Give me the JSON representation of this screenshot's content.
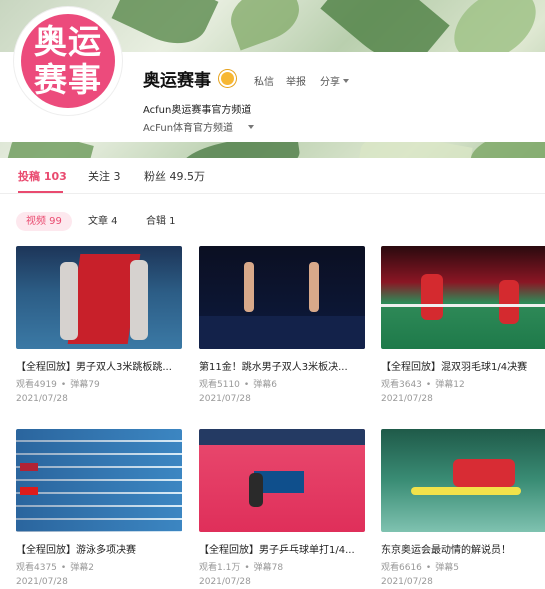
{
  "header": {
    "avatar_text": "奥运\n赛事",
    "username": "奥运赛事",
    "actions": [
      "私信",
      "举报",
      "分享"
    ],
    "signature": "Acfun奥运赛事官方频道",
    "verify": "AcFun体育官方频道"
  },
  "tabs": [
    {
      "label": "投稿 103",
      "active": true
    },
    {
      "label": "关注 3",
      "active": false
    },
    {
      "label": "粉丝 49.5万",
      "active": false
    }
  ],
  "subtabs": [
    {
      "label": "视频 99",
      "active": true
    },
    {
      "label": "文章 4",
      "active": false
    },
    {
      "label": "合辑 1",
      "active": false
    }
  ],
  "videos": [
    {
      "title": "【全程回放】男子双人3米跳板跳...",
      "views": "观看4919",
      "danmaku": "弹幕79",
      "date": "2021/07/28"
    },
    {
      "title": "第11金！跳水男子双人3米板决...",
      "views": "观看5110",
      "danmaku": "弹幕6",
      "date": "2021/07/28"
    },
    {
      "title": "【全程回放】混双羽毛球1/4决赛",
      "views": "观看3643",
      "danmaku": "弹幕12",
      "date": "2021/07/28"
    },
    {
      "title": "【全程回放】游泳多项决赛",
      "views": "观看4375",
      "danmaku": "弹幕2",
      "date": "2021/07/28"
    },
    {
      "title": "【全程回放】男子乒乓球单打1/4...",
      "views": "观看1.1万",
      "danmaku": "弹幕78",
      "date": "2021/07/28"
    },
    {
      "title": "东京奥运会最动情的解说员！",
      "views": "观看6616",
      "danmaku": "弹幕5",
      "date": "2021/07/28"
    }
  ],
  "colors": {
    "accent": "#e94a6f",
    "avatar_bg": "#ec4b7c"
  }
}
